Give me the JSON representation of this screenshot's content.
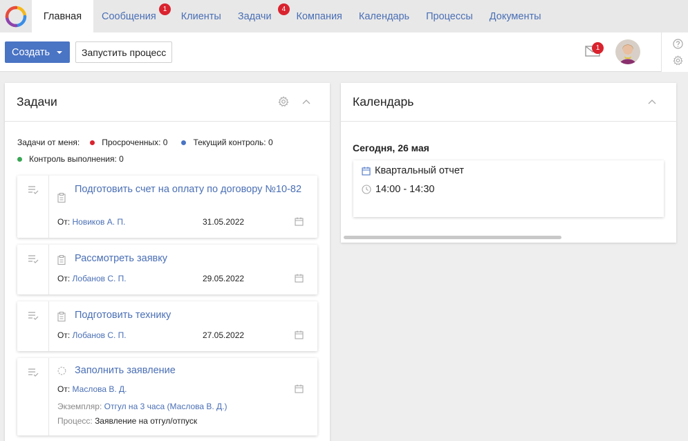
{
  "nav": {
    "tabs": [
      {
        "label": "Главная",
        "active": true
      },
      {
        "label": "Сообщения",
        "badge": "1"
      },
      {
        "label": "Клиенты"
      },
      {
        "label": "Задачи",
        "badge": "4"
      },
      {
        "label": "Компания"
      },
      {
        "label": "Календарь"
      },
      {
        "label": "Процессы"
      },
      {
        "label": "Документы"
      }
    ]
  },
  "toolbar": {
    "create_label": "Создать",
    "run_process_label": "Запустить процесс",
    "mail_badge": "1"
  },
  "tasks_panel": {
    "title": "Задачи",
    "legend_prefix": "Задачи от меня:",
    "overdue": "Просроченных: 0",
    "current": "Текущий контроль: 0",
    "execution": "Контроль выполнения: 0",
    "cards": [
      {
        "title": "Подготовить счет на оплату по договору №10-82",
        "from_label": "От:",
        "from": "Новиков А. П.",
        "date": "31.05.2022"
      },
      {
        "title": "Рассмотреть заявку",
        "from_label": "От:",
        "from": "Лобанов С. П.",
        "date": "29.05.2022"
      },
      {
        "title": "Подготовить технику",
        "from_label": "От:",
        "from": "Лобанов С. П.",
        "date": "27.05.2022"
      },
      {
        "title": "Заполнить заявление",
        "from_label": "От:",
        "from": "Маслова В. Д.",
        "date": "",
        "instance_label": "Экземпляр:",
        "instance": "Отгул на 3 часа (Маслова В. Д.)",
        "process_label": "Процесс:",
        "process": "Заявление на отгул/отпуск"
      }
    ]
  },
  "calendar_panel": {
    "title": "Календарь",
    "today": "Сегодня, 26 мая",
    "event_title": "Квартальный отчет",
    "event_time": "14:00 - 14:30"
  },
  "colors": {
    "accent": "#4a74c4",
    "link": "#4a6fb5",
    "badge": "#d9232e",
    "overdue_dot": "#d9232e",
    "current_dot": "#4a74c4",
    "execution_dot": "#3aa655"
  }
}
